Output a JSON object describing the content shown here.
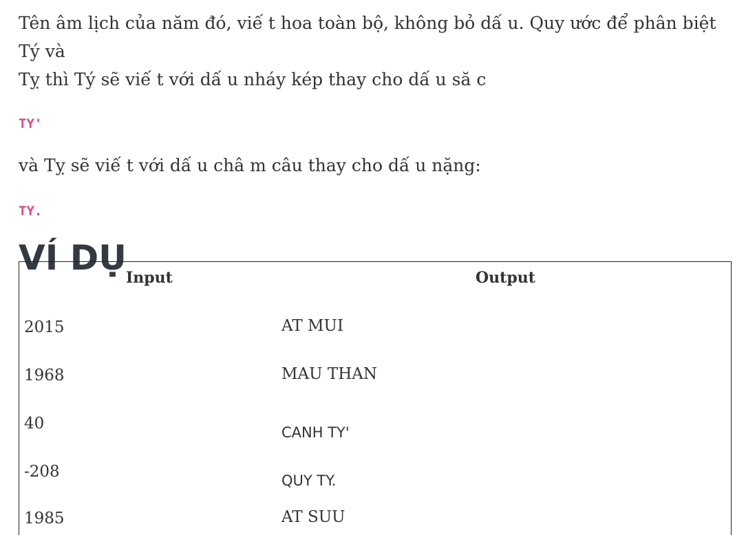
{
  "intro": {
    "text_line1": "Tên âm lịch của năm đó, viế t hoa toàn bộ, không bỏ dấ u. Quy ước để phân biệt Tý và",
    "text_line2": "Tỵ thì Tý sẽ viế t với dấ u nháy kép thay cho dấ u să c"
  },
  "code_ty_quote": "TY'",
  "para_ty_dot": "và Tỵ sẽ viế t với dấ u châ m câu thay cho dấ u nặng:",
  "code_ty_dot": "TY.",
  "examples_heading": "VÍ DỤ",
  "examples": {
    "headers": {
      "input": "Input",
      "output": "Output"
    },
    "rows": [
      {
        "input": "2015",
        "output": "AT MUI"
      },
      {
        "input": "1968",
        "output": "MAU THAN"
      },
      {
        "input": "40",
        "output": "CANH TY'"
      },
      {
        "input": "-208",
        "output": "QUY TY."
      },
      {
        "input": "1985",
        "output": "AT SUU"
      }
    ]
  }
}
